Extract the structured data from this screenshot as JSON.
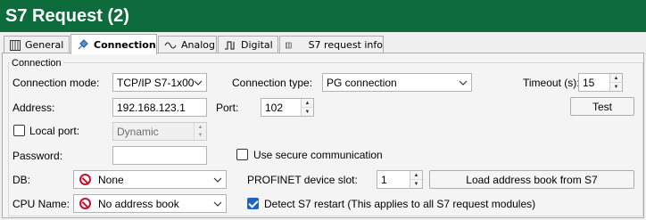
{
  "window": {
    "title": "S7 Request (2)"
  },
  "tabs": [
    {
      "label": "General",
      "icon": "grid-icon"
    },
    {
      "label": "Connection",
      "icon": "plug-icon"
    },
    {
      "label": "Analog",
      "icon": "wave-icon"
    },
    {
      "label": "Digital",
      "icon": "pulse-icon"
    },
    {
      "label": "S7 request info",
      "icon": "grid-icon"
    }
  ],
  "active_tab": "Connection",
  "connection": {
    "group_label": "Connection",
    "mode_label": "Connection mode:",
    "mode_value": "TCP/IP S7-1x00",
    "type_label": "Connection type:",
    "type_value": "PG connection",
    "timeout_label": "Timeout (s):",
    "timeout_value": "15",
    "test_label": "Test",
    "address_label": "Address:",
    "address_value": "192.168.123.1",
    "port_label": "Port:",
    "port_value": "102",
    "local_port_label": "Local port:",
    "local_port_checked": false,
    "local_port_value": "Dynamic",
    "password_label": "Password:",
    "password_value": "",
    "secure_label": "Use secure communication",
    "secure_checked": false,
    "db_label": "DB:",
    "db_value": "None",
    "slot_label": "PROFINET device slot:",
    "slot_value": "1",
    "load_address_book_label": "Load address book from S7",
    "cpu_label": "CPU Name:",
    "cpu_value": "No address book",
    "detect_restart_label": "Detect S7 restart (This applies to all S7 request modules)",
    "detect_restart_checked": true
  },
  "colors": {
    "title_bar": "#0e6b3c",
    "title_text": "#ffffff",
    "checkbox_checked": "#1a66c2",
    "no_symbol": "#c8102e"
  }
}
